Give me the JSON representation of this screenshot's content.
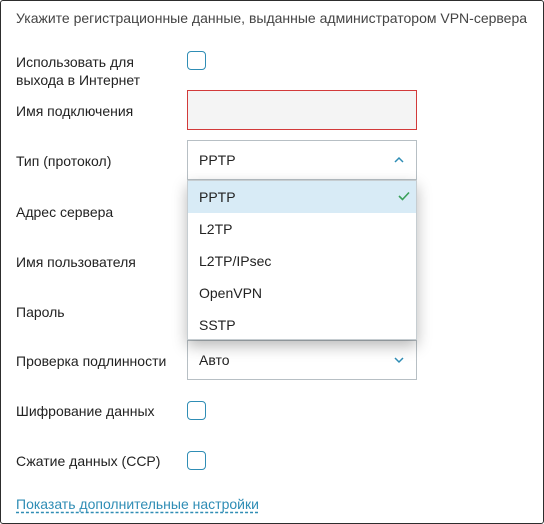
{
  "header": "Укажите регистрационные данные, выданные администратором VPN-сервера",
  "fields": {
    "use_for_internet": {
      "label_line1": "Использовать для",
      "label_line2": "выхода в Интернет",
      "checked": false
    },
    "connection_name": {
      "label": "Имя подключения",
      "value": ""
    },
    "protocol": {
      "label": "Тип (протокол)",
      "value": "PPTP"
    },
    "server_address": {
      "label": "Адрес сервера"
    },
    "username": {
      "label": "Имя пользователя"
    },
    "password": {
      "label": "Пароль"
    },
    "auth_check": {
      "label": "Проверка подлинности",
      "value": "Авто"
    },
    "encryption": {
      "label": "Шифрование данных",
      "checked": false
    },
    "compression": {
      "label": "Сжатие данных (CCP)",
      "checked": false
    }
  },
  "protocol_options": [
    "PPTP",
    "L2TP",
    "L2TP/IPsec",
    "OpenVPN",
    "SSTP"
  ],
  "selected_protocol": "PPTP",
  "show_more_link": "Показать дополнительные настройки",
  "colors": {
    "accent": "#2f8db5",
    "error": "#d23a3a",
    "selected_bg": "#d8ebf6",
    "check": "#3aa05a"
  },
  "icons": {
    "select_open": "chevron-up-icon",
    "select_closed": "chevron-down-icon",
    "selected": "checkmark-icon"
  }
}
